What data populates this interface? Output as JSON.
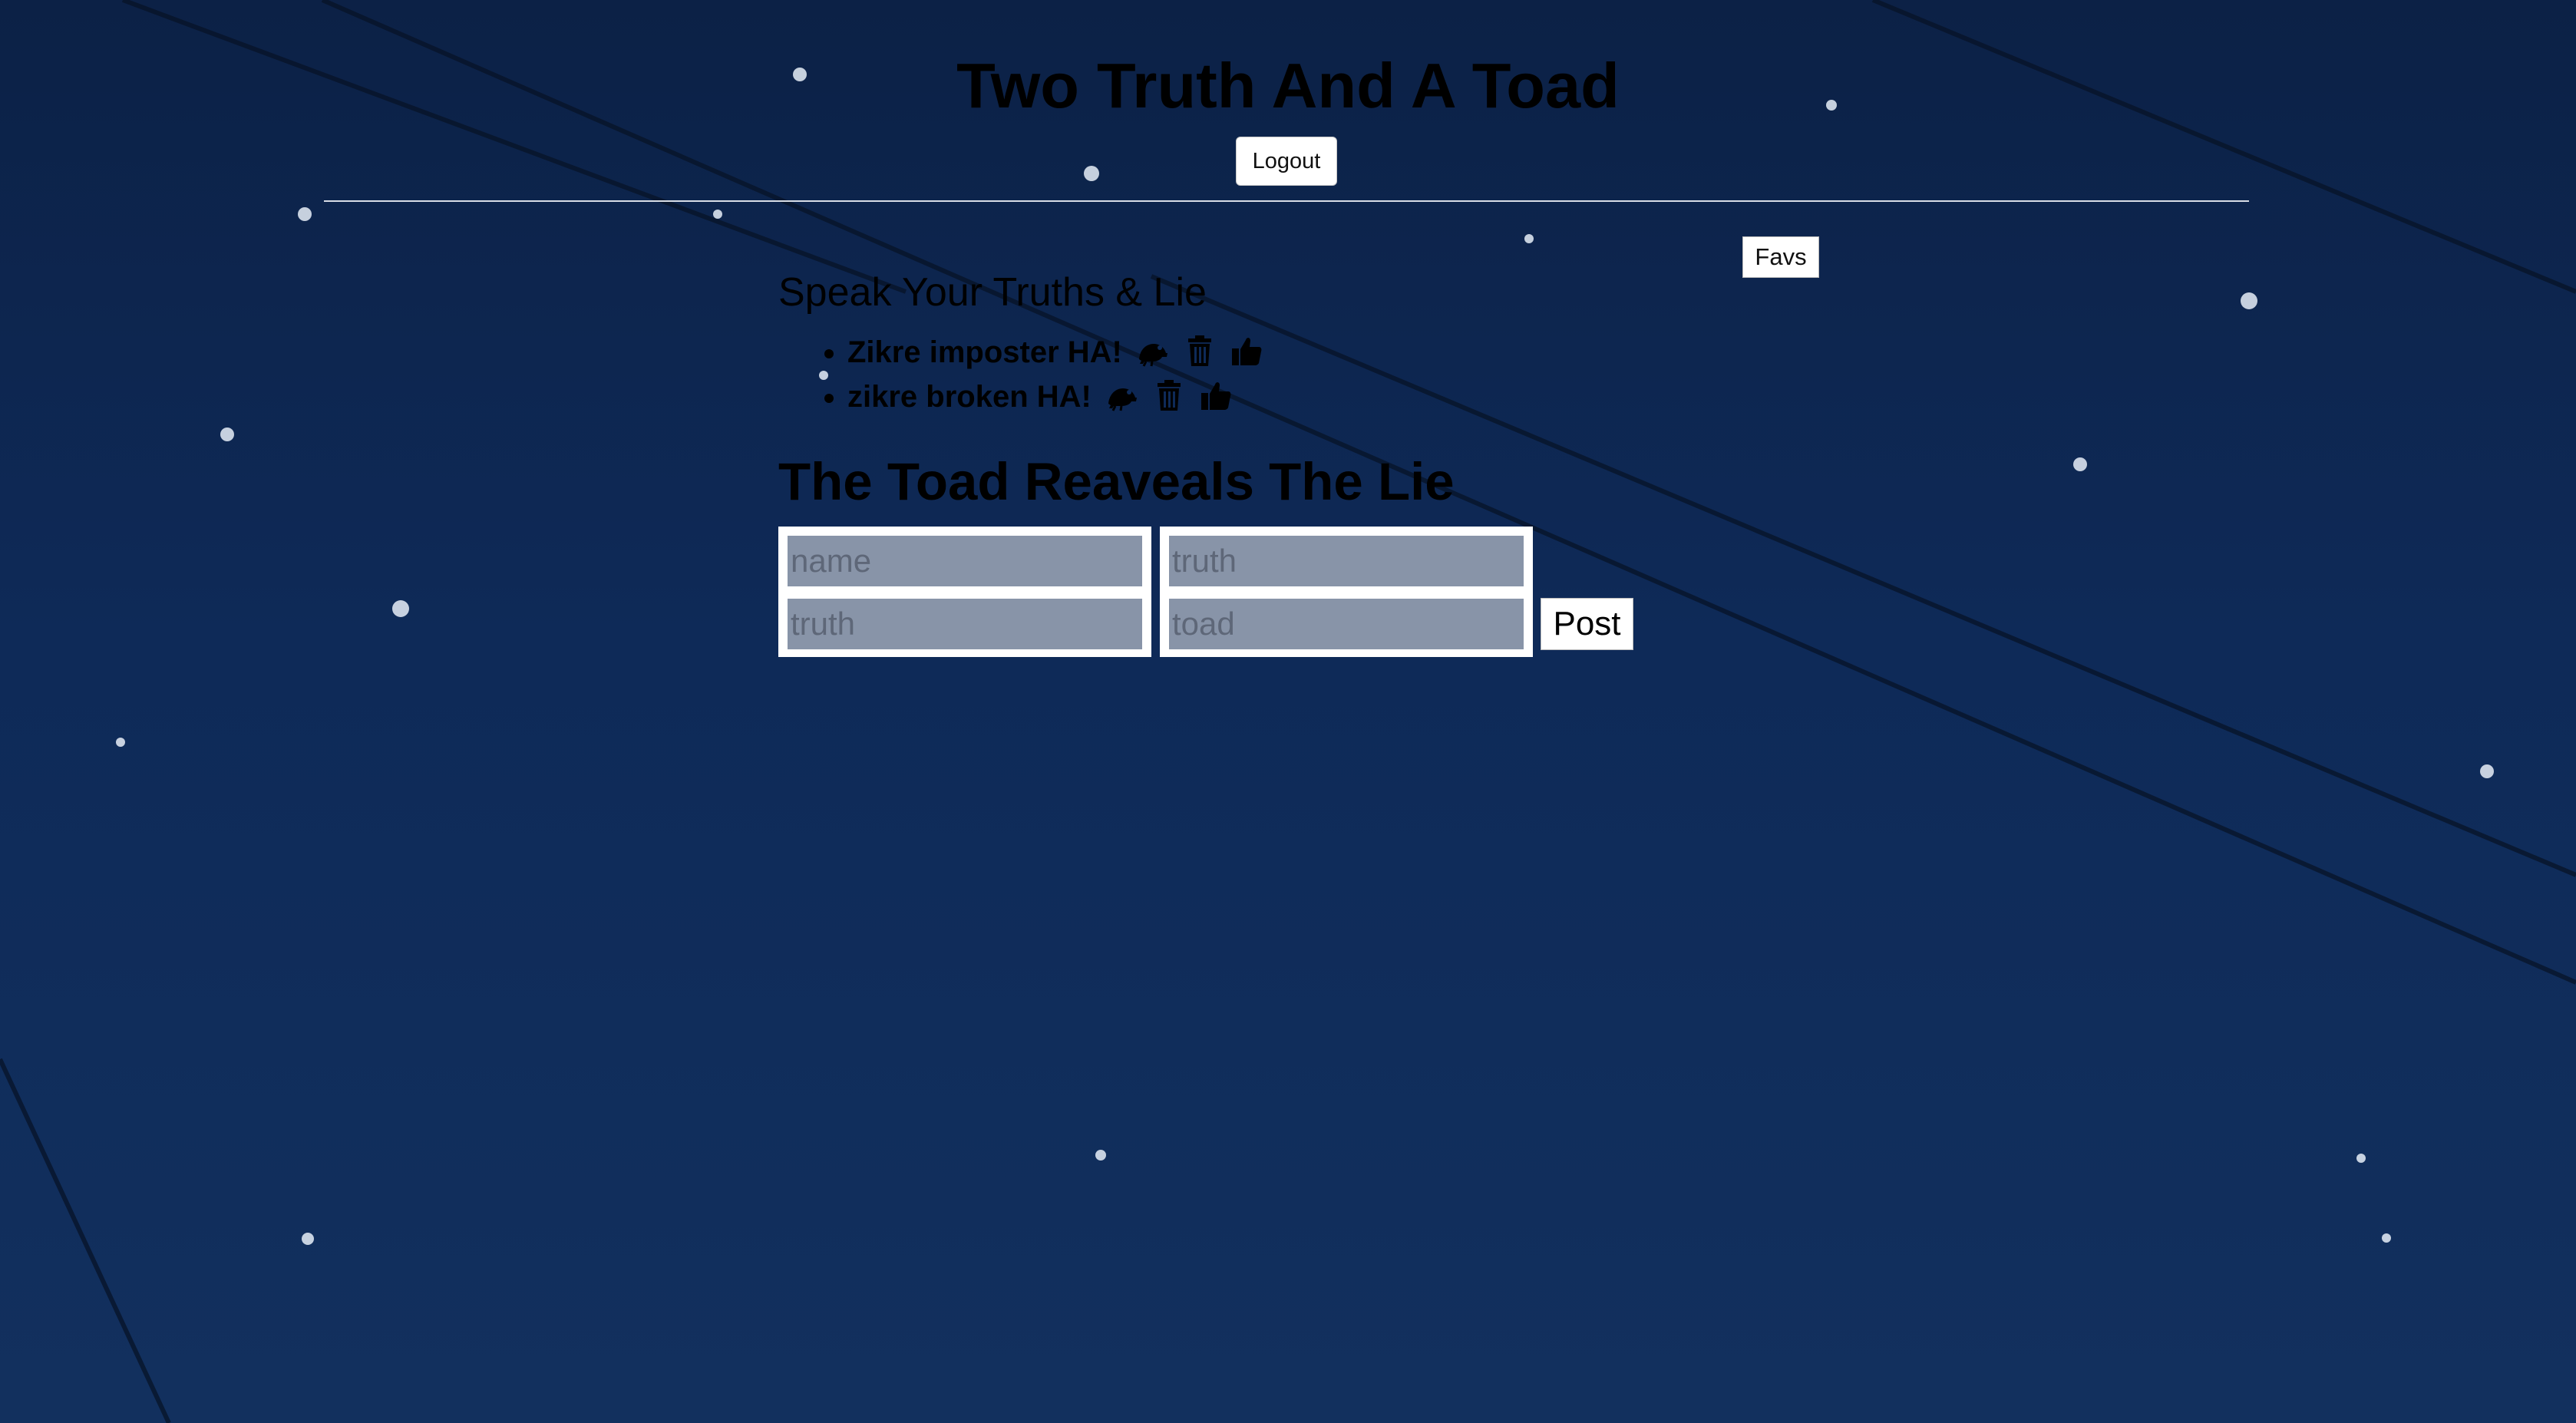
{
  "header": {
    "title": "Two Truth And A Toad",
    "logout_label": "Logout"
  },
  "favs_label": "Favs",
  "truths": {
    "heading": "Speak Your Truths & Lie",
    "entries": [
      {
        "text": "Zikre imposter HA!",
        "icons": [
          "toad-icon",
          "trash-icon",
          "thumbs-up-icon"
        ]
      },
      {
        "text": "zikre broken HA!",
        "icons": [
          "toad-icon",
          "trash-icon",
          "thumbs-up-icon"
        ]
      }
    ]
  },
  "form": {
    "heading": "The Toad Reaveals The Lie",
    "name_placeholder": "name",
    "truth1_placeholder": "truth",
    "truth2_placeholder": "truth",
    "toad_placeholder": "toad",
    "post_label": "Post"
  },
  "colors": {
    "sky_top": "#0c2146",
    "sky_bottom": "#12305e",
    "input_fill": "#8894a8"
  }
}
